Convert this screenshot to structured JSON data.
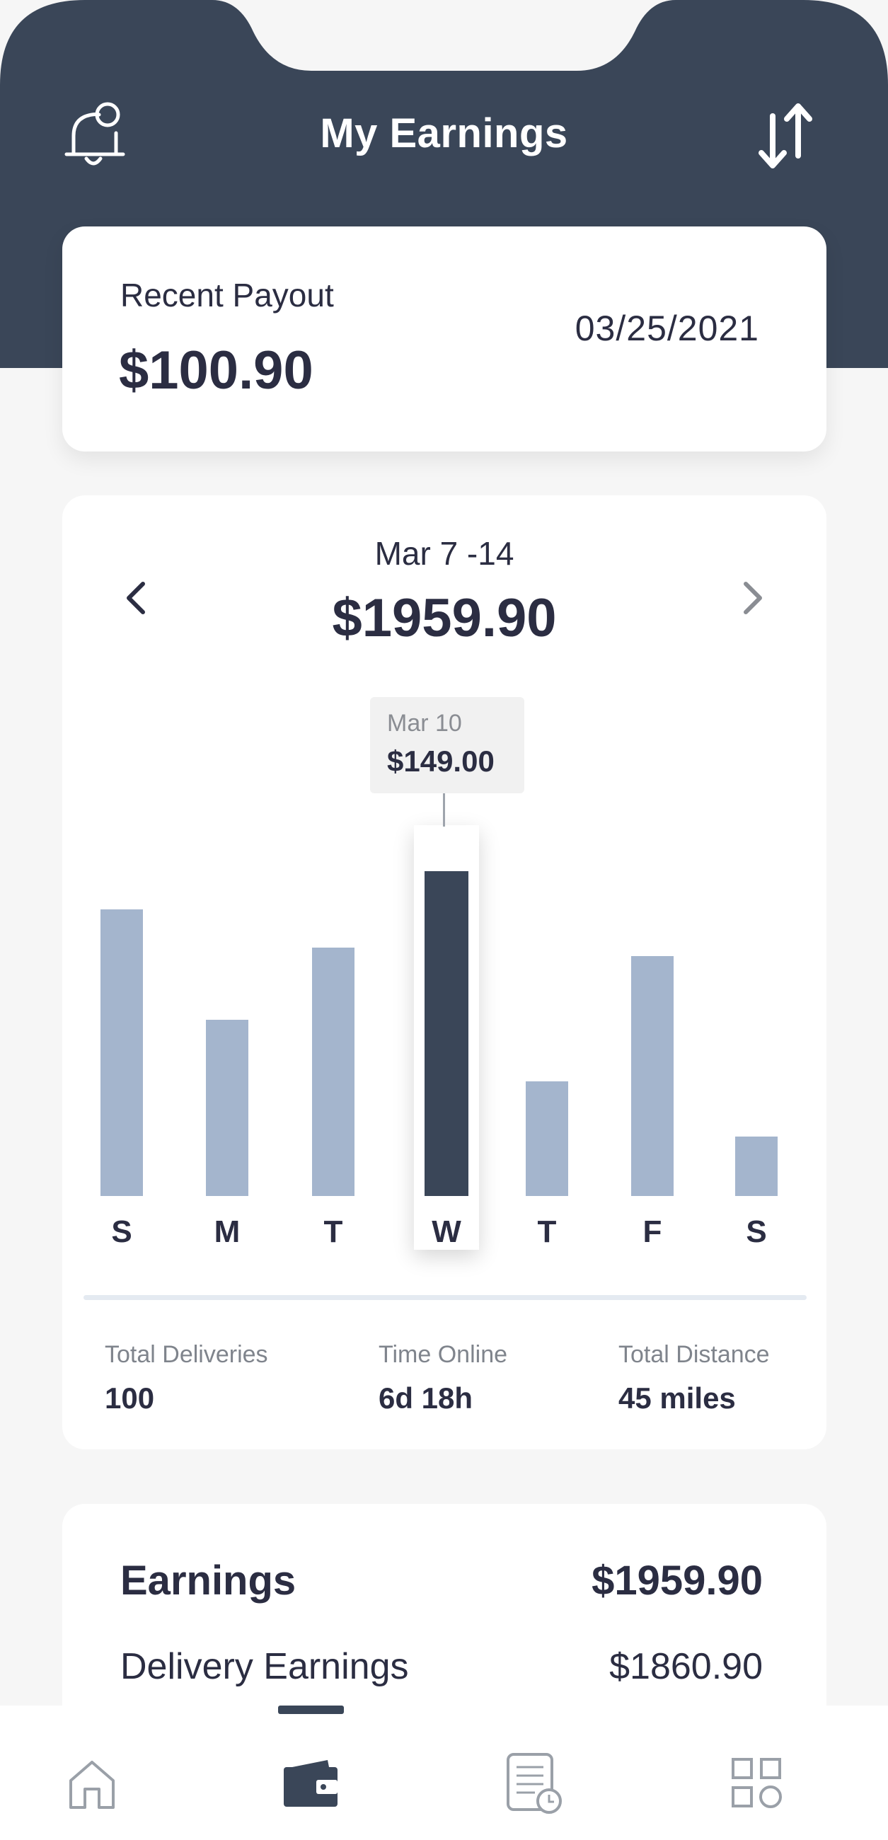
{
  "header": {
    "title": "My Earnings",
    "background_color": "#3a4658",
    "left_icon": "bell-notification-icon",
    "right_icon": "sort-arrows-icon"
  },
  "recent_payout": {
    "label": "Recent Payout",
    "amount": "$100.90",
    "date": "03/25/2021"
  },
  "weekly_summary": {
    "range": "Mar 7 -14",
    "total": "$1959.90",
    "prev_icon": "chevron-left-icon",
    "next_icon": "chevron-right-icon",
    "tooltip": {
      "date": "Mar 10",
      "value": "$149.00"
    }
  },
  "chart_data": {
    "type": "bar",
    "categories": [
      "S",
      "M",
      "T",
      "W",
      "T",
      "F",
      "S"
    ],
    "values": [
      135,
      83,
      117,
      153,
      54,
      113,
      28
    ],
    "highlighted_index": 3,
    "colors": {
      "bar": "#a4b5cd",
      "highlight": "#3a4658"
    }
  },
  "stats": [
    {
      "label": "Total Deliveries",
      "value": "100"
    },
    {
      "label": "Time Online",
      "value": "6d 18h"
    },
    {
      "label": "Total Distance",
      "value": "45 miles"
    }
  ],
  "earnings": {
    "title": "Earnings",
    "total": "$1959.90",
    "delivery_label": "Delivery Earnings",
    "delivery_value": "$1860.90"
  },
  "bottom_nav": {
    "active": "wallet",
    "items": [
      "home-icon",
      "wallet-icon",
      "orders-history-icon",
      "apps-grid-icon"
    ]
  }
}
